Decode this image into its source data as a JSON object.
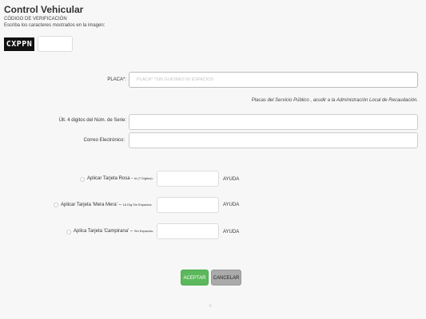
{
  "header": {
    "title": "Control Vehicular",
    "code_label": "CÓDIGO DE VERIFICACIÓN",
    "code_hint": "Escriba los caracteres mostrados en la imagen:",
    "captcha_text": "CXPPN"
  },
  "form": {
    "placa_label": "PLACA*:",
    "placa_placeholder": "PLACA* *SIN GUIONES NI ESPACIOS",
    "placa_note": "Placas del Servicio Público , acudir a la Administración Local de Recaudación.",
    "serie_label": "Últ. 4 digitos del Núm. de Serie:",
    "email_label": "Correo Electrónico:"
  },
  "options": [
    {
      "label": "Aplicar Tarjeta Rosa - ",
      "note": "Id (7 Digitos):",
      "help": "AYUDA"
    },
    {
      "label": "Aplicar Tarjeta 'Mera Mera' – ",
      "note": "16 Dig Sin Espacios:",
      "help": "AYUDA"
    },
    {
      "label": "Aplica Tarjeta 'Campirana' – ",
      "note": "Sin Espacios:",
      "help": "AYUDA"
    }
  ],
  "buttons": {
    "accept": "ACEPTAR",
    "cancel": "CANCELAR"
  }
}
